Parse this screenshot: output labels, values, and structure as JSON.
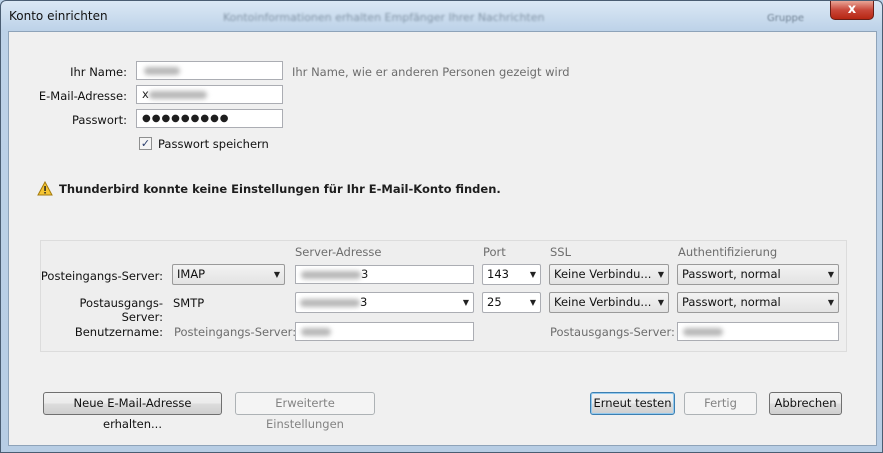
{
  "window": {
    "title": "Konto einrichten",
    "background_title": "Kontoinformationen erhalten Empfänger Ihrer Nachrichten",
    "background_right": "Gruppe",
    "close_label": "x"
  },
  "form": {
    "name": {
      "label": "Ihr Name:",
      "value": "",
      "hint": "Ihr Name, wie er anderen Personen gezeigt wird"
    },
    "email": {
      "label": "E-Mail-Adresse:",
      "value": "x"
    },
    "password": {
      "label": "Passwort:",
      "value": "●●●●●●●●●"
    },
    "remember_password": {
      "label": "Passwort speichern",
      "checked": true,
      "mark": "✓"
    }
  },
  "warning": {
    "icon": "warning-icon",
    "glyph": "⚠",
    "text": "Thunderbird konnte keine Einstellungen für Ihr E-Mail-Konto finden."
  },
  "server_table": {
    "headers": {
      "server": "Server-Adresse",
      "port": "Port",
      "ssl": "SSL",
      "auth": "Authentifizierung"
    },
    "incoming": {
      "label": "Posteingangs-Server:",
      "protocol": "IMAP",
      "server_suffix": "3",
      "port": "143",
      "ssl": "Keine Verbindu...",
      "auth": "Passwort, normal"
    },
    "outgoing": {
      "label": "Postausgangs-Server:",
      "protocol": "SMTP",
      "server_suffix": "3",
      "port": "25",
      "ssl": "Keine Verbindu...",
      "auth": "Passwort, normal"
    },
    "username": {
      "label": "Benutzername:",
      "incoming_label": "Posteingangs-Server:",
      "outgoing_label": "Postausgangs-Server:"
    }
  },
  "buttons": {
    "new_address": "Neue E-Mail-Adresse erhalten...",
    "advanced": "Erweiterte Einstellungen",
    "retest": "Erneut testen",
    "done": "Fertig",
    "cancel": "Abbrechen"
  },
  "icons": {
    "dropdown": "▼"
  }
}
